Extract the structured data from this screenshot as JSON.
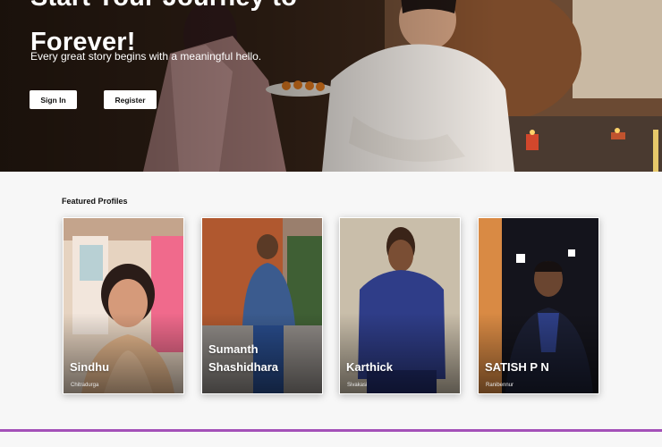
{
  "hero": {
    "title_line1": "Start Your Journey to",
    "title_line2": "Forever!",
    "subtitle": "Every great story begins with a meaningful hello.",
    "signin_label": "Sign In",
    "register_label": "Register"
  },
  "featured": {
    "title": "Featured Profiles",
    "profiles": [
      {
        "name": "Sindhu",
        "city": "Chitradurga"
      },
      {
        "name": "Sumanth Shashidhara",
        "city": ""
      },
      {
        "name": "Karthick",
        "city": "Sivakasi"
      },
      {
        "name": "SATISH P N",
        "city": "Ranibennur"
      }
    ]
  },
  "colors": {
    "accent_line": "#a450b8",
    "button_bg": "#ffffff"
  }
}
